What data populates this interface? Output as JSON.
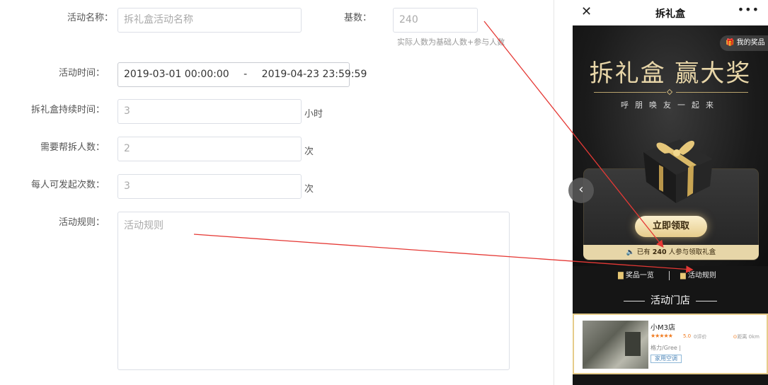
{
  "form": {
    "activity_name": {
      "label": "活动名称：",
      "placeholder": "拆礼盒活动名称"
    },
    "base_count": {
      "label": "基数：",
      "value": "240",
      "hint": "实际人数为基础人数+参与人数"
    },
    "activity_time": {
      "label": "活动时间：",
      "start": "2019-03-01 00:00:00",
      "separator": "-",
      "end": "2019-04-23 23:59:59"
    },
    "duration": {
      "label": "拆礼盒持续时间：",
      "value": "3",
      "unit": "小时"
    },
    "helpers_needed": {
      "label": "需要帮拆人数：",
      "value": "2",
      "unit": "次"
    },
    "launch_times": {
      "label": "每人可发起次数：",
      "value": "3",
      "unit": "次"
    },
    "rules": {
      "label": "活动规则：",
      "placeholder": "活动规则"
    }
  },
  "phone": {
    "close_glyph": "✕",
    "title": "拆礼盒",
    "more_glyph": "•••",
    "my_prize": "我的奖品",
    "main_title": "拆礼盒 赢大奖",
    "subtitle": "呼朋唤友一起来",
    "claim_button": "立即领取",
    "join_prefix": "已有",
    "join_count": "240",
    "join_suffix": "人参与领取礼盒",
    "prize_list": "奖品一览",
    "activity_rules": "活动规则",
    "store_heading": "活动门店",
    "store": {
      "name": "小M3店",
      "stars": "★★★★★",
      "score": "5.0",
      "reviews": "0评价",
      "distance": "距离 0km",
      "brand": "格力/Gree |",
      "tag": "家用空调"
    },
    "prev_arrow": "‹"
  },
  "colors": {
    "gold": "#e7d6a8",
    "arrow": "#e53935"
  }
}
